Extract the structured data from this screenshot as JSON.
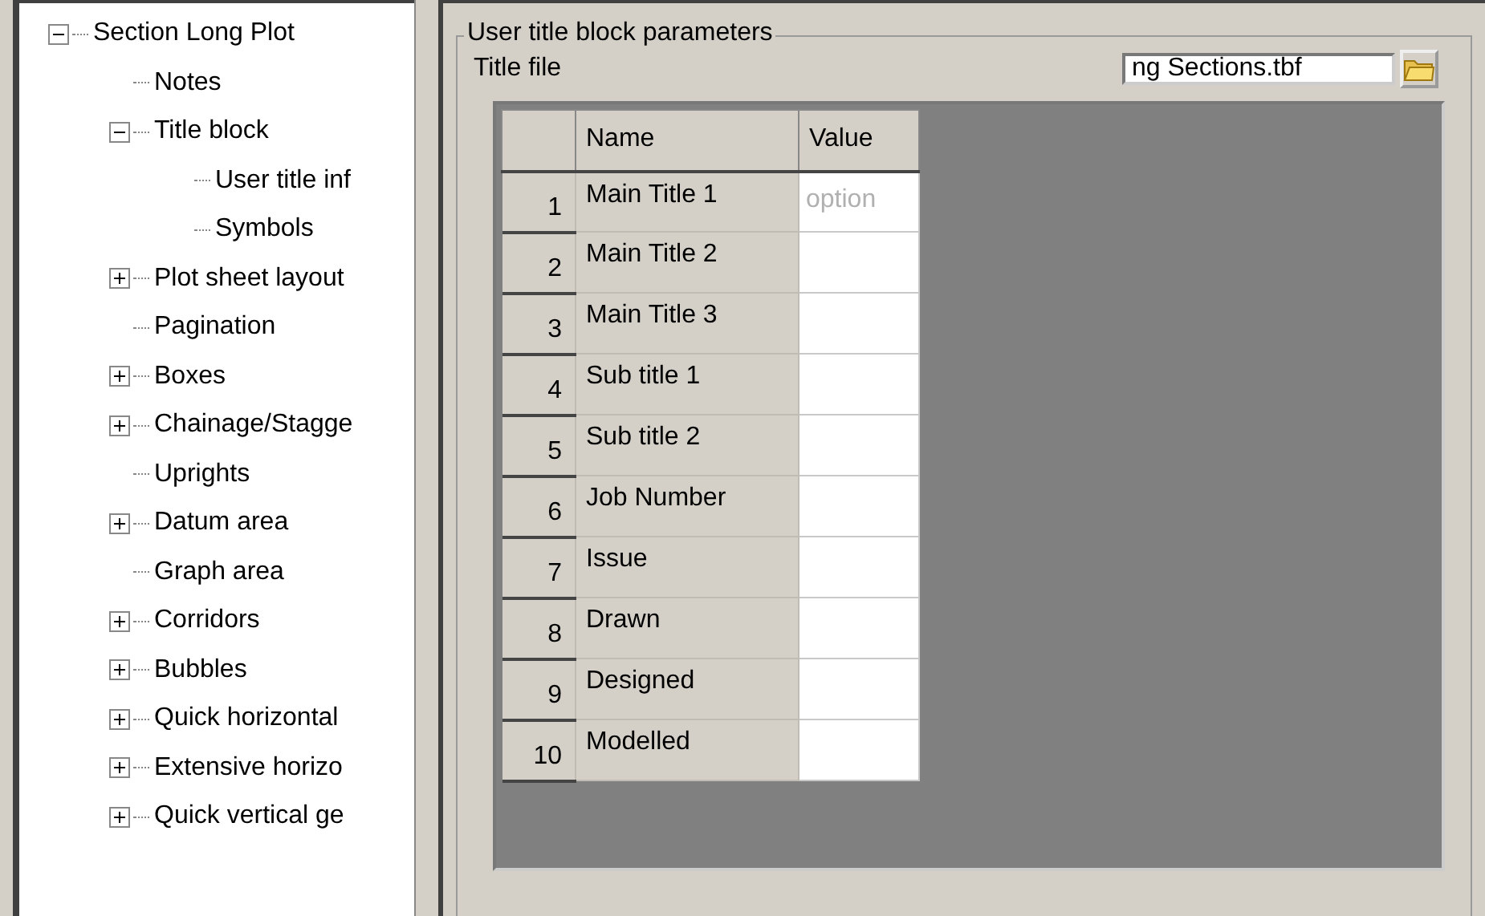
{
  "tree": [
    {
      "label": "Section Long Plot",
      "expanded": true,
      "children": [
        {
          "label": "Notes"
        },
        {
          "label": "Title block",
          "expanded": true,
          "children": [
            {
              "label": "User title inf"
            },
            {
              "label": "Symbols"
            }
          ]
        },
        {
          "label": "Plot sheet layout",
          "expanded": false
        },
        {
          "label": "Pagination"
        },
        {
          "label": "Boxes",
          "expanded": false
        },
        {
          "label": "Chainage/Stagge",
          "expanded": false
        },
        {
          "label": "Uprights"
        },
        {
          "label": "Datum area",
          "expanded": false
        },
        {
          "label": "Graph area"
        },
        {
          "label": "Corridors",
          "expanded": false
        },
        {
          "label": "Bubbles",
          "expanded": false
        },
        {
          "label": "Quick horizontal",
          "expanded": false
        },
        {
          "label": "Extensive horizo",
          "expanded": false
        },
        {
          "label": "Quick vertical ge",
          "expanded": false
        }
      ]
    }
  ],
  "group": {
    "title": "User title block parameters",
    "title_file_label": "Title file",
    "title_file_value": "ng Sections.tbf",
    "table": {
      "columns": [
        "Name",
        "Value"
      ],
      "rows": [
        {
          "number": "1",
          "name": "Main Title 1",
          "placeholder": "option"
        },
        {
          "number": "2",
          "name": "Main Title 2"
        },
        {
          "number": "3",
          "name": "Main Title 3"
        },
        {
          "number": "4",
          "name": "Sub title 1"
        },
        {
          "number": "5",
          "name": "Sub title 2"
        },
        {
          "number": "6",
          "name": "Job Number"
        },
        {
          "number": "7",
          "name": "Issue"
        },
        {
          "number": "8",
          "name": "Drawn"
        },
        {
          "number": "9",
          "name": "Designed"
        },
        {
          "number": "10",
          "name": "Modelled"
        }
      ]
    }
  }
}
